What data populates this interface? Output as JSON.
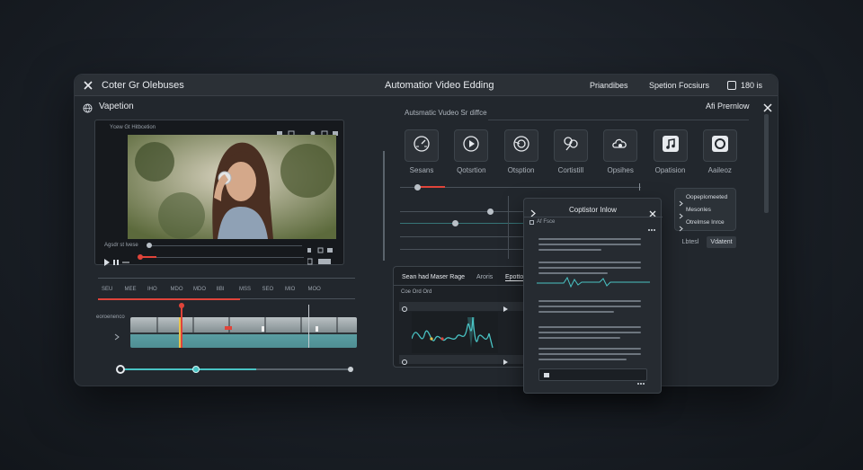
{
  "window": {
    "left_title": "Coter Gr Olebuses",
    "center_title": "Automatior Video Edding",
    "menu_1": "Priandibes",
    "menu_2": "Spetion Focsiurs",
    "badge": "180 is"
  },
  "left": {
    "section_title": "Vapetion",
    "video_top_label": "Ycew Gt Hitbcetion",
    "video_time_label": "Agsdr st lvese",
    "timecodes": [
      "SEU",
      "MEE",
      "IHO",
      "MDO",
      "MDO",
      "IIBI",
      "MSS",
      "SEO",
      "MIO",
      "MOO"
    ],
    "track_label": "eoroenenco"
  },
  "right": {
    "section_label": "Autsmatic Vudeo Sr diffce",
    "preview_title": "Afi Prernlow",
    "tools": [
      {
        "icon": "speed-dial-icon",
        "label": "Sesans"
      },
      {
        "icon": "play-circle-icon",
        "label": "Qotsrtion"
      },
      {
        "icon": "sync-icon",
        "label": "Otsption"
      },
      {
        "icon": "search-people-icon",
        "label": "Cortistill"
      },
      {
        "icon": "cloud-settings-icon",
        "label": "Opsihes"
      },
      {
        "icon": "music-note-icon",
        "label": "Opatision"
      },
      {
        "icon": "record-icon",
        "label": "Aaileoz"
      }
    ],
    "options": [
      "Oopeplomeeted",
      "Mesonles",
      "Otrelmse Inrce"
    ],
    "btn_1": "Lbtesl",
    "btn_2": "Vdatent"
  },
  "waveform_panel": {
    "tab_1": "Sean had Maser Rage",
    "tab_2": "Aroris",
    "tab_3": "Epotton",
    "subtitle": "Coe Ord Ord"
  },
  "caption_dialog": {
    "title": "Coptistor Inlow",
    "sub_label": "Af Fsce",
    "footer_icon": "caption-icon"
  },
  "colors": {
    "accent_red": "#e0443a",
    "accent_teal": "#49c3c4",
    "accent_yellow": "#e7c34a"
  }
}
